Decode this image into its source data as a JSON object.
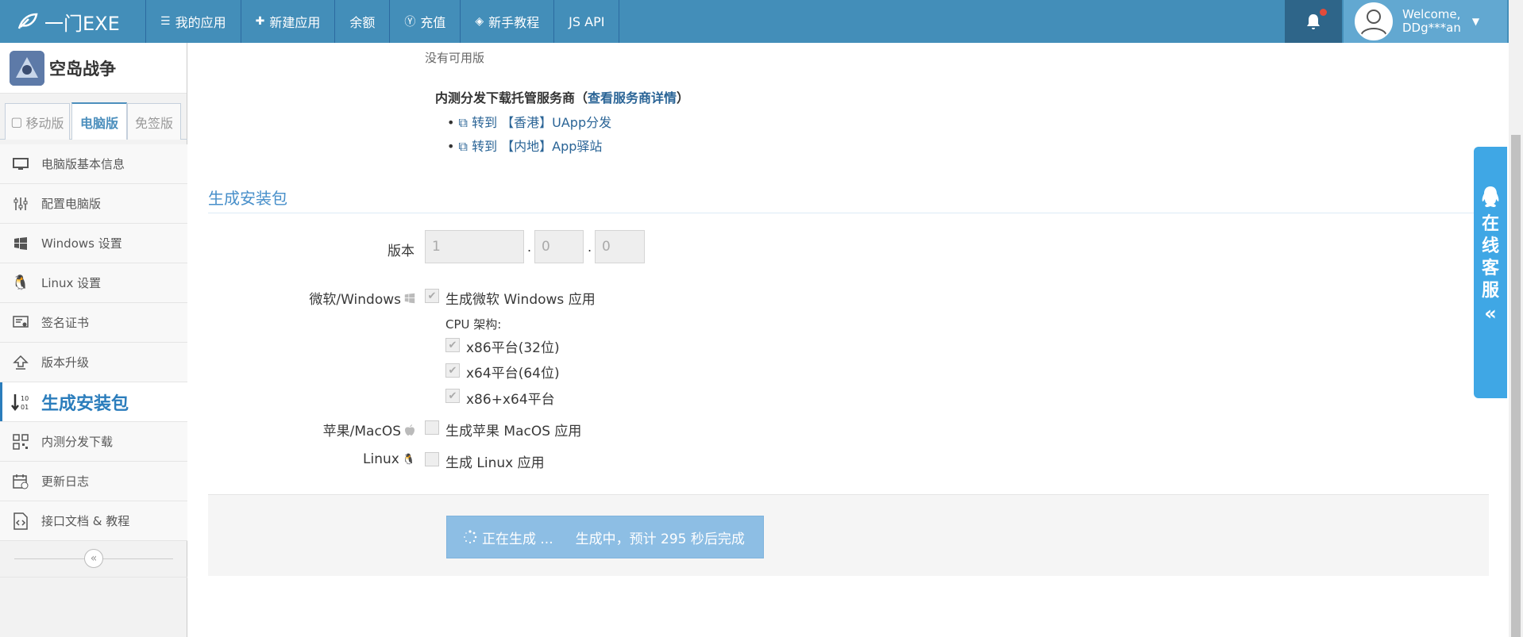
{
  "navbar": {
    "brand": "一门EXE",
    "items": [
      {
        "icon": "list-icon",
        "label": "我的应用"
      },
      {
        "icon": "plus-icon",
        "label": "新建应用"
      },
      {
        "icon": "",
        "label": "余额"
      },
      {
        "icon": "yen-circle-icon",
        "label": "充值"
      },
      {
        "icon": "diamond-icon",
        "label": "新手教程"
      },
      {
        "icon": "",
        "label": "JS API"
      }
    ],
    "user": {
      "welcome": "Welcome,",
      "name": "DDg***an"
    }
  },
  "sidebar": {
    "app_name": "空岛战争",
    "tabs": [
      {
        "label": "移动版",
        "active": false
      },
      {
        "label": "电脑版",
        "active": true
      },
      {
        "label": "免签版",
        "active": false
      }
    ],
    "items": [
      {
        "label": "电脑版基本信息",
        "icon": "monitor-icon"
      },
      {
        "label": "配置电脑版",
        "icon": "sliders-icon"
      },
      {
        "label": "Windows 设置",
        "icon": "windows-icon"
      },
      {
        "label": "Linux 设置",
        "icon": "linux-icon"
      },
      {
        "label": "签名证书",
        "icon": "certificate-icon"
      },
      {
        "label": "版本升级",
        "icon": "upgrade-icon"
      },
      {
        "label": "生成安装包",
        "icon": "sort-numeric-icon",
        "active": true
      },
      {
        "label": "内测分发下载",
        "icon": "qrcode-icon"
      },
      {
        "label": "更新日志",
        "icon": "calendar-icon"
      },
      {
        "label": "接口文档 & 教程",
        "icon": "code-file-icon"
      }
    ]
  },
  "main": {
    "no_version": "没有可用版",
    "hosting": {
      "title": "内测分发下载托管服务商（",
      "title_link": "查看服务商详情",
      "title_end": "）",
      "links": [
        "转到 【香港】UApp分发",
        "转到 【内地】App驿站"
      ]
    },
    "section_title": "生成安装包",
    "version": {
      "label": "版本",
      "major": "1",
      "minor": "0",
      "patch": "0"
    },
    "windows": {
      "label": "微软/Windows",
      "checkbox": "生成微软 Windows 应用",
      "checked": true,
      "cpu_label": "CPU 架构:",
      "arch": [
        "x86平台(32位)",
        "x64平台(64位)",
        "x86+x64平台"
      ]
    },
    "mac": {
      "label": "苹果/MacOS",
      "checkbox": "生成苹果 MacOS 应用",
      "checked": false
    },
    "linux": {
      "label": "Linux",
      "checkbox": "生成 Linux 应用",
      "checked": false
    },
    "generate_button": {
      "status": "正在生成 ...",
      "message": "生成中，预计 295 秒后完成"
    }
  },
  "chat_widget": {
    "chars": [
      "在",
      "线",
      "客",
      "服"
    ]
  },
  "colors": {
    "navbar": "#438eb9",
    "accent": "#2b7dbc",
    "chat": "#3fa7e5",
    "button": "#8dbee4"
  }
}
